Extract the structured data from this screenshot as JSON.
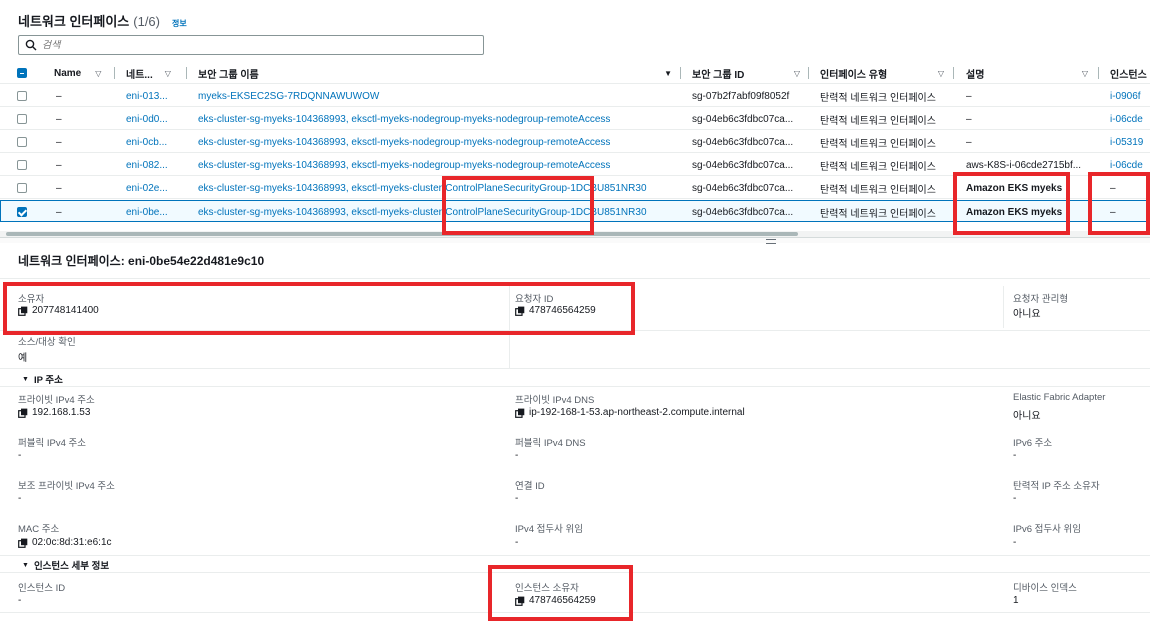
{
  "header": {
    "title": "네트워크 인터페이스",
    "count": "(1/6)",
    "info": "정보"
  },
  "search": {
    "placeholder": "검색"
  },
  "columns": [
    {
      "label": "Name",
      "sort": "▽"
    },
    {
      "label": "네트...",
      "sort": "▽"
    },
    {
      "label": "보안 그룹 이름",
      "sort": "▼"
    },
    {
      "label": "보안 그룹 ID",
      "sort": "▽"
    },
    {
      "label": "인터페이스 유형",
      "sort": "▽"
    },
    {
      "label": "설명",
      "sort": "▽"
    },
    {
      "label": "인스턴스"
    }
  ],
  "rows": [
    {
      "name": "–",
      "eni": "eni-013...",
      "sg_name": "myeks-EKSEC2SG-7RDQNNAWUWOW",
      "sg_id": "sg-07b2f7abf09f8052f",
      "type": "탄력적 네트워크 인터페이스",
      "desc": "–",
      "instance": "i-0906f"
    },
    {
      "name": "–",
      "eni": "eni-0d0...",
      "sg_name": "eks-cluster-sg-myeks-104368993, eksctl-myeks-nodegroup-myeks-nodegroup-remoteAccess",
      "sg_id": "sg-04eb6c3fdbc07ca...",
      "type": "탄력적 네트워크 인터페이스",
      "desc": "–",
      "instance": "i-06cde"
    },
    {
      "name": "–",
      "eni": "eni-0cb...",
      "sg_name": "eks-cluster-sg-myeks-104368993, eksctl-myeks-nodegroup-myeks-nodegroup-remoteAccess",
      "sg_id": "sg-04eb6c3fdbc07ca...",
      "type": "탄력적 네트워크 인터페이스",
      "desc": "–",
      "instance": "i-05319"
    },
    {
      "name": "–",
      "eni": "eni-082...",
      "sg_name": "eks-cluster-sg-myeks-104368993, eksctl-myeks-nodegroup-myeks-nodegroup-remoteAccess",
      "sg_id": "sg-04eb6c3fdbc07ca...",
      "type": "탄력적 네트워크 인터페이스",
      "desc": "aws-K8S-i-06cde2715bf...",
      "instance": "i-06cde"
    },
    {
      "name": "–",
      "eni": "eni-02e...",
      "sg_name": "eks-cluster-sg-myeks-104368993, eksctl-myeks-cluster-ControlPlaneSecurityGroup-1DCBU851NR30",
      "sg_id": "sg-04eb6c3fdbc07ca...",
      "type": "탄력적 네트워크 인터페이스",
      "desc": "Amazon EKS myeks",
      "instance": "–"
    },
    {
      "name": "–",
      "eni": "eni-0be...",
      "sg_name": "eks-cluster-sg-myeks-104368993, eksctl-myeks-cluster-ControlPlaneSecurityGroup-1DCBU851NR30",
      "sg_id": "sg-04eb6c3fdbc07ca...",
      "type": "탄력적 네트워크 인터페이스",
      "desc": "Amazon EKS myeks",
      "instance": "–",
      "selected": true
    }
  ],
  "details": {
    "title": "네트워크 인터페이스: eni-0be54e22d481e9c10",
    "owner": {
      "label": "소유자",
      "value": "207748141400"
    },
    "requester_id": {
      "label": "요청자 ID",
      "value": "478746564259"
    },
    "requester_managed": {
      "label": "요청자 관리형",
      "value": "아니요"
    },
    "source_dest_check": {
      "label": "소스/대상 확인",
      "value": "예"
    },
    "ip_section": "IP 주소",
    "private_ipv4": {
      "label": "프라이빗 IPv4 주소",
      "value": "192.168.1.53"
    },
    "private_ipv4_dns": {
      "label": "프라이빗 IPv4 DNS",
      "value": "ip-192-168-1-53.ap-northeast-2.compute.internal"
    },
    "efa": {
      "label": "Elastic Fabric Adapter",
      "value": "아니요"
    },
    "public_ipv4": {
      "label": "퍼블릭 IPv4 주소",
      "value": "-"
    },
    "public_ipv4_dns": {
      "label": "퍼블릭 IPv4 DNS",
      "value": "-"
    },
    "ipv6": {
      "label": "IPv6 주소",
      "value": "-"
    },
    "secondary_private_ipv4": {
      "label": "보조 프라이빗 IPv4 주소",
      "value": "-"
    },
    "association_id": {
      "label": "연결 ID",
      "value": "-"
    },
    "elastic_ip_owner": {
      "label": "탄력적 IP 주소 소유자",
      "value": "-"
    },
    "mac": {
      "label": "MAC 주소",
      "value": "02:0c:8d:31:e6:1c"
    },
    "ipv4_prefix": {
      "label": "IPv4 접두사 위임",
      "value": "-"
    },
    "ipv6_prefix": {
      "label": "IPv6 접두사 위임",
      "value": "-"
    },
    "instance_section": "인스턴스 세부 정보",
    "instance_id": {
      "label": "인스턴스 ID",
      "value": "-"
    },
    "instance_owner": {
      "label": "인스턴스 소유자",
      "value": "478746564259"
    },
    "device_index": {
      "label": "디바이스 인덱스",
      "value": "1"
    }
  },
  "colors": {
    "link": "#0073bb",
    "highlight": "#e8262a",
    "selected_bg": "#f1faff"
  },
  "icons": {
    "search": "search-icon",
    "copy": "copy-icon",
    "caret": "caret-down-icon"
  }
}
